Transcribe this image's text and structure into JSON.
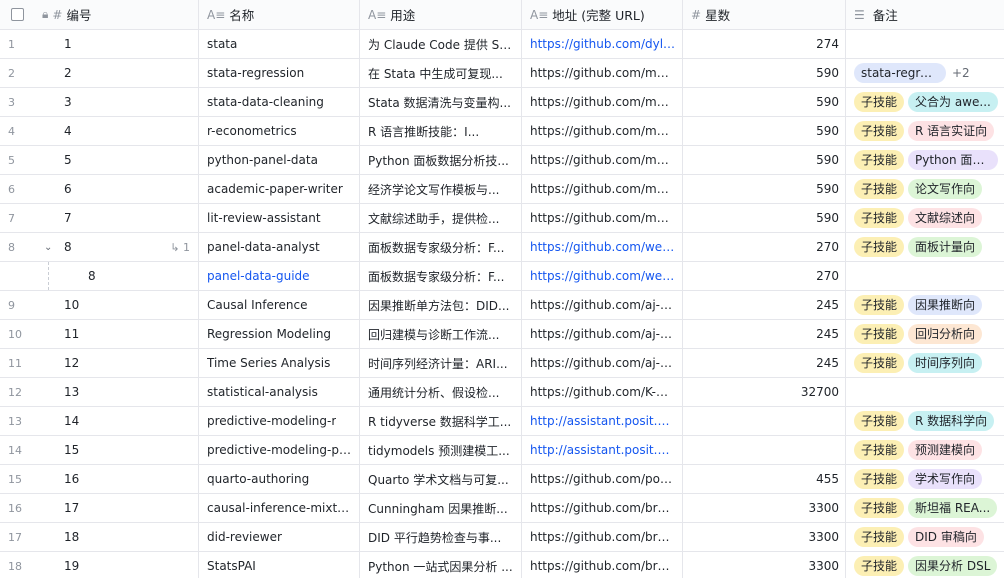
{
  "header": {
    "num_label": "编号",
    "name_label": "名称",
    "purpose_label": "用途",
    "url_label": "地址 (完整 URL)",
    "stars_label": "星数",
    "notes_label": "备注"
  },
  "tag_colors": {
    "yellow": "#fcefb4",
    "cyan": "#c7f0f2",
    "pink": "#fde2e4",
    "purple": "#e9e1fb",
    "green": "#dcf5d6",
    "blue": "#dfe7fb",
    "orange": "#fde7d3"
  },
  "rows": [
    {
      "row": "1",
      "num": "1",
      "name": "stata",
      "purpose": "为 Claude Code 提供 St...",
      "url": "https://github.com/dyla...",
      "url_link": true,
      "stars": "274",
      "tags": []
    },
    {
      "row": "2",
      "num": "2",
      "name": "stata-regression",
      "purpose": "在 Stata 中生成可复现...",
      "url": "https://github.com/mele...",
      "url_link": false,
      "stars": "590",
      "tags": [
        {
          "label": "stata-regression ...",
          "color": "blue"
        }
      ],
      "more": "+2"
    },
    {
      "row": "3",
      "num": "3",
      "name": "stata-data-cleaning",
      "purpose": "Stata 数据清洗与变量构...",
      "url": "https://github.com/mele...",
      "url_link": false,
      "stars": "590",
      "tags": [
        {
          "label": "子技能",
          "color": "yellow"
        },
        {
          "label": "父合为 awe...",
          "color": "cyan"
        }
      ]
    },
    {
      "row": "4",
      "num": "4",
      "name": "r-econometrics",
      "purpose": "R 语言推断技能：I...",
      "url": "https://github.com/mele...",
      "url_link": false,
      "stars": "590",
      "tags": [
        {
          "label": "子技能",
          "color": "yellow"
        },
        {
          "label": "R 语言实证向",
          "color": "pink"
        }
      ]
    },
    {
      "row": "5",
      "num": "5",
      "name": "python-panel-data",
      "purpose": "Python 面板数据分析技...",
      "url": "https://github.com/mele...",
      "url_link": false,
      "stars": "590",
      "tags": [
        {
          "label": "子技能",
          "color": "yellow"
        },
        {
          "label": "Python 面板...",
          "color": "purple"
        }
      ]
    },
    {
      "row": "6",
      "num": "6",
      "name": "academic-paper-writer",
      "purpose": "经济学论文写作模板与...",
      "url": "https://github.com/mele...",
      "url_link": false,
      "stars": "590",
      "tags": [
        {
          "label": "子技能",
          "color": "yellow"
        },
        {
          "label": "论文写作向",
          "color": "green"
        }
      ]
    },
    {
      "row": "7",
      "num": "7",
      "name": "lit-review-assistant",
      "purpose": "文献综述助手，提供检...",
      "url": "https://github.com/mele...",
      "url_link": false,
      "stars": "590",
      "tags": [
        {
          "label": "子技能",
          "color": "yellow"
        },
        {
          "label": "文献综述向",
          "color": "pink"
        }
      ]
    },
    {
      "row": "8",
      "num": "8",
      "name": "panel-data-analyst",
      "purpose": "面板数据专家级分析：F...",
      "url": "https://github.com/went...",
      "url_link": true,
      "stars": "270",
      "tags": [
        {
          "label": "子技能",
          "color": "yellow"
        },
        {
          "label": "面板计量向",
          "color": "green"
        }
      ],
      "expandable": true,
      "subcount": "1"
    },
    {
      "row": "",
      "num": "8",
      "name": "panel-data-guide",
      "name_link": true,
      "purpose": "面板数据专家级分析：F...",
      "url": "https://github.com/went...",
      "url_link": true,
      "stars": "270",
      "tags": [],
      "sub": true
    },
    {
      "row": "9",
      "num": "10",
      "name": "Causal Inference",
      "purpose": "因果推断单方法包：DID...",
      "url": "https://github.com/aj-g...",
      "url_link": false,
      "stars": "245",
      "tags": [
        {
          "label": "子技能",
          "color": "yellow"
        },
        {
          "label": "因果推断向",
          "color": "blue"
        }
      ]
    },
    {
      "row": "10",
      "num": "11",
      "name": "Regression Modeling",
      "purpose": "回归建模与诊断工作流...",
      "url": "https://github.com/aj-g...",
      "url_link": false,
      "stars": "245",
      "tags": [
        {
          "label": "子技能",
          "color": "yellow"
        },
        {
          "label": "回归分析向",
          "color": "orange"
        }
      ]
    },
    {
      "row": "11",
      "num": "12",
      "name": "Time Series Analysis",
      "purpose": "时间序列经济计量：ARI...",
      "url": "https://github.com/aj-g...",
      "url_link": false,
      "stars": "245",
      "tags": [
        {
          "label": "子技能",
          "color": "yellow"
        },
        {
          "label": "时间序列向",
          "color": "cyan"
        }
      ]
    },
    {
      "row": "12",
      "num": "13",
      "name": "statistical-analysis",
      "purpose": "通用统计分析、假设检...",
      "url": "https://github.com/K-De...",
      "url_link": false,
      "stars": "32700",
      "tags": []
    },
    {
      "row": "13",
      "num": "14",
      "name": "predictive-modeling-r",
      "purpose": "R tidyverse 数据科学工...",
      "url": "http://assistant.posit.co...",
      "url_link": true,
      "stars": "",
      "tags": [
        {
          "label": "子技能",
          "color": "yellow"
        },
        {
          "label": "R 数据科学向",
          "color": "cyan"
        }
      ]
    },
    {
      "row": "14",
      "num": "15",
      "name": "predictive-modeling-pyt...",
      "purpose": "tidymodels 预测建模工...",
      "url": "http://assistant.posit.co...",
      "url_link": true,
      "stars": "",
      "tags": [
        {
          "label": "子技能",
          "color": "yellow"
        },
        {
          "label": "预测建模向",
          "color": "pink"
        }
      ]
    },
    {
      "row": "15",
      "num": "16",
      "name": "quarto-authoring",
      "purpose": "Quarto 学术文档与可复...",
      "url": "https://github.com/posit...",
      "url_link": false,
      "stars": "455",
      "tags": [
        {
          "label": "子技能",
          "color": "yellow"
        },
        {
          "label": "学术写作向",
          "color": "purple"
        }
      ]
    },
    {
      "row": "16",
      "num": "17",
      "name": "causal-inference-mixtape",
      "purpose": "Cunningham 因果推断...",
      "url": "https://github.com/bryc...",
      "url_link": false,
      "stars": "3300",
      "tags": [
        {
          "label": "子技能",
          "color": "yellow"
        },
        {
          "label": "斯坦福 REA...",
          "color": "green"
        }
      ]
    },
    {
      "row": "17",
      "num": "18",
      "name": "did-reviewer",
      "purpose": "DID 平行趋势检查与事...",
      "url": "https://github.com/bryc...",
      "url_link": false,
      "stars": "3300",
      "tags": [
        {
          "label": "子技能",
          "color": "yellow"
        },
        {
          "label": "DID 审稿向",
          "color": "pink"
        }
      ]
    },
    {
      "row": "18",
      "num": "19",
      "name": "StatsPAI",
      "purpose": "Python 一站式因果分析 ...",
      "url": "https://github.com/bryc...",
      "url_link": false,
      "stars": "3300",
      "tags": [
        {
          "label": "子技能",
          "color": "yellow"
        },
        {
          "label": "因果分析 DSL",
          "color": "green"
        }
      ]
    }
  ]
}
